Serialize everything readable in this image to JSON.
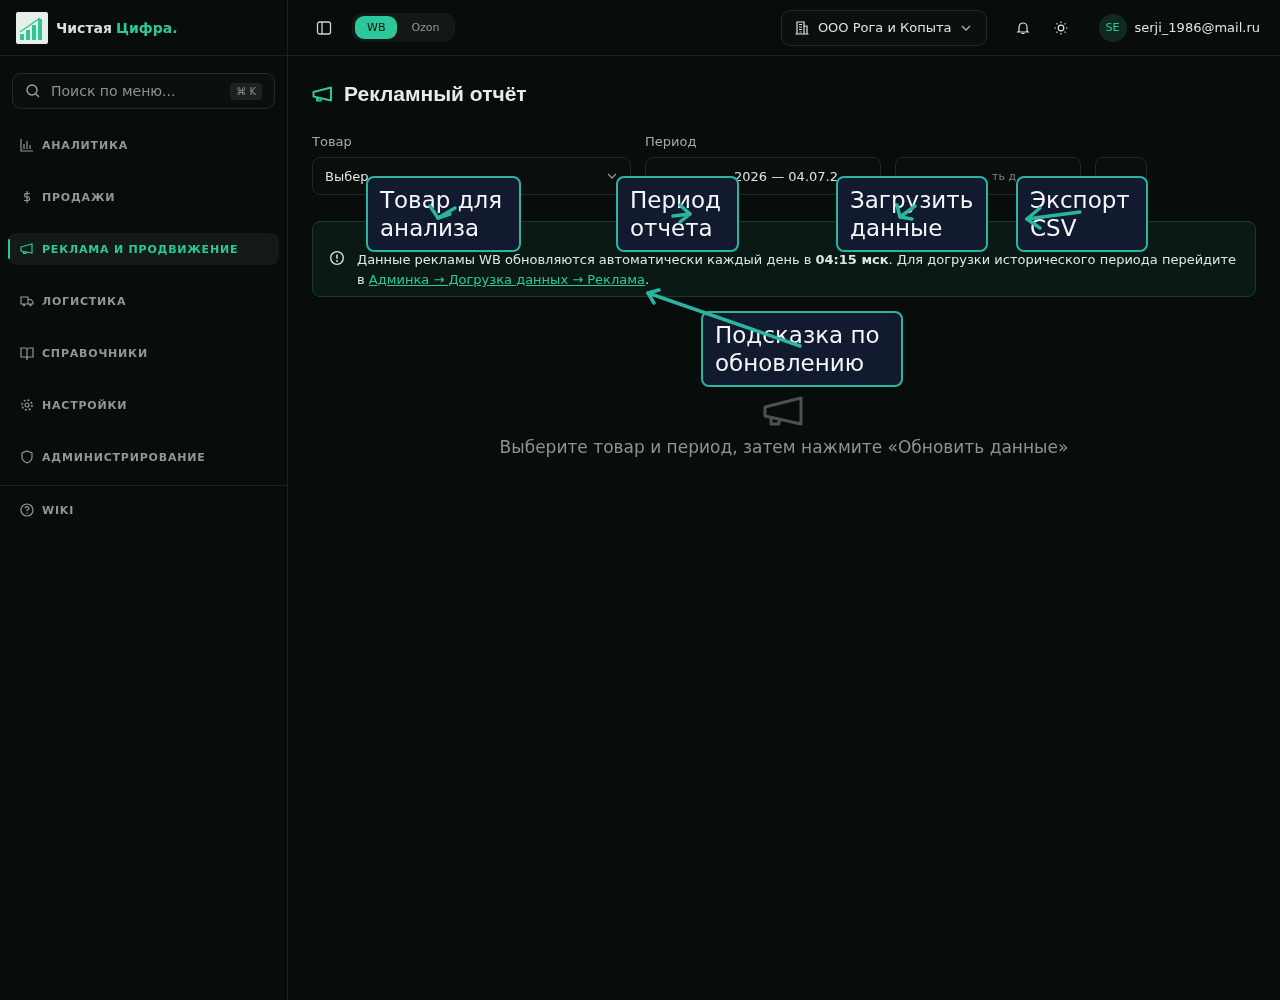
{
  "brand": {
    "name": "Чистая",
    "accent": "Цифра."
  },
  "search": {
    "placeholder": "Поиск по меню...",
    "shortcut": "⌘ K"
  },
  "sidebar": {
    "items": [
      {
        "label": "АНАЛИТИКА",
        "selected": false
      },
      {
        "label": "ПРОДАЖИ",
        "selected": false
      },
      {
        "label": "РЕКЛАМА И ПРОДВИЖЕНИЕ",
        "selected": true
      },
      {
        "label": "ЛОГИСТИКА",
        "selected": false
      },
      {
        "label": "СПРАВОЧНИКИ",
        "selected": false
      },
      {
        "label": "НАСТРОЙКИ",
        "selected": false
      },
      {
        "label": "АДМИНИСТРИРОВАНИЕ",
        "selected": false
      }
    ],
    "footer_items": [
      {
        "label": "WIKI",
        "selected": false
      }
    ]
  },
  "marketplaces": [
    {
      "label": "WB",
      "selected": true
    },
    {
      "label": "Ozon",
      "selected": false
    }
  ],
  "company": "ООО Рога и Копыта",
  "user": {
    "initials": "SE",
    "email": "serji_1986@mail.ru"
  },
  "page": {
    "title": "Рекламный отчёт",
    "filters": {
      "product_label": "Товар",
      "product_value": "Выбер",
      "period_label": "Период",
      "period_value": "2026 — 04.07.2",
      "load_button": "ть д"
    },
    "info": {
      "text": "Данные рекламы WB обновляются автоматически каждый день в **04:15 мск**. Для догрузки исторического периода перейдите в ",
      "link": "Админка → Догрузка данных → Реклама",
      "after": "."
    },
    "empty_text": "Выберите товар и период, затем нажмите «Обновить данные»"
  },
  "annotations": [
    {
      "text": "Товар для анализа"
    },
    {
      "text": "Период отчета"
    },
    {
      "text": "Загрузить данные"
    },
    {
      "text": "Экспорт CSV"
    },
    {
      "text": "Подсказка по обновлению"
    }
  ]
}
